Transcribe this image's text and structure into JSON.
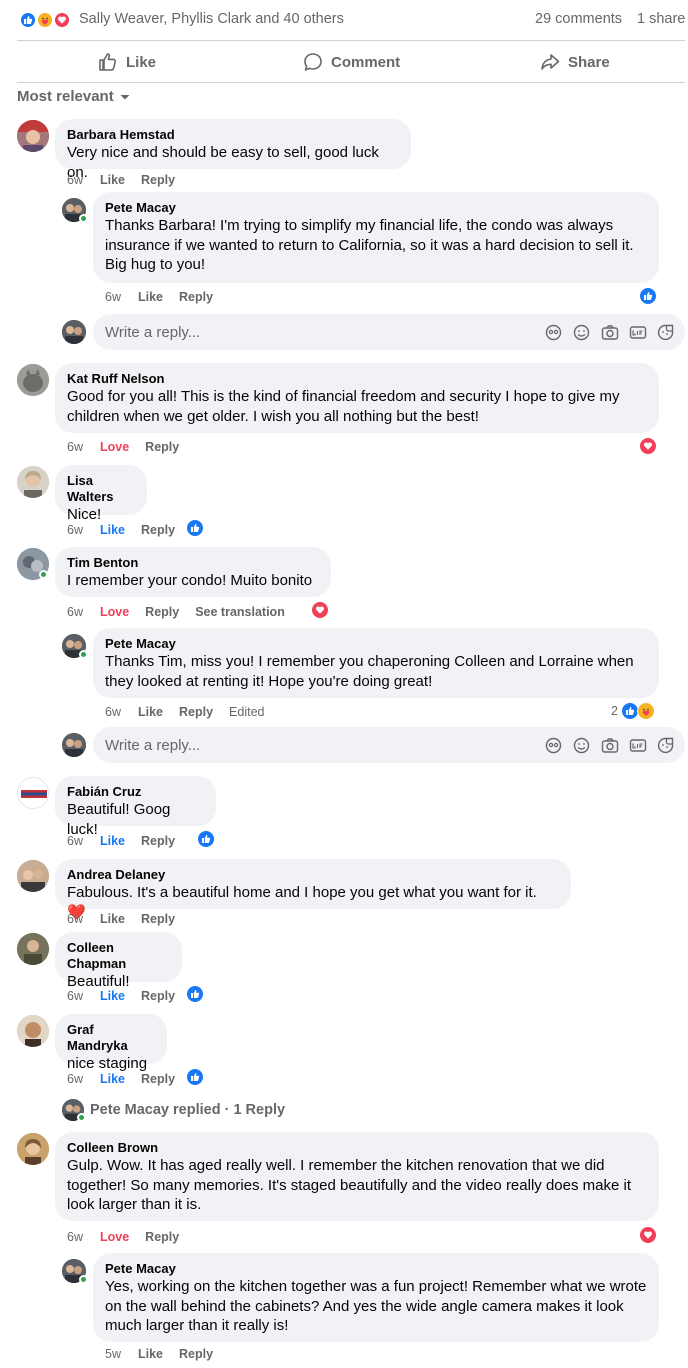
{
  "summary": {
    "reactions": [
      "like-icon",
      "care-icon",
      "love-icon"
    ],
    "names": "Sally Weaver, Phyllis Clark and 40 others",
    "comments": "29 comments",
    "shares": "1 share"
  },
  "actions": {
    "like": "Like",
    "comment": "Comment",
    "share": "Share"
  },
  "sort": {
    "label": "Most relevant"
  },
  "reply_placeholder": "Write a reply...",
  "labels": {
    "like": "Like",
    "reply": "Reply",
    "love": "Love",
    "edited": "Edited",
    "see_translation": "See translation"
  },
  "colors": {
    "like": "#1877f2",
    "love": "#f33e58",
    "care": "#f7b125",
    "bubble": "#f0f2f5",
    "meta": "#65676b"
  },
  "comments": [
    {
      "author": "Barbara Hemstad",
      "lines": [
        "Very nice and should be easy to sell, good luck on."
      ],
      "time": "6w"
    },
    {
      "author": "Pete Macay",
      "lines": [
        "Thanks Barbara! I'm trying to simplify my financial life, the condo was always",
        "insurance if we wanted to return to California, so it was a hard decision to sell it.",
        "Big hug to you!"
      ],
      "time": "6w"
    },
    {
      "author": "Kat Ruff Nelson",
      "lines": [
        "Good for you all! This is the kind of financial freedom and security I hope to give my",
        "children when we get older. I wish you all nothing but the best!"
      ],
      "time": "6w"
    },
    {
      "author": "Lisa Walters",
      "lines": [
        "Nice!"
      ],
      "time": "6w"
    },
    {
      "author": "Tim Benton",
      "lines": [
        "I remember your condo! Muito bonito"
      ],
      "time": "6w"
    },
    {
      "author": "Pete Macay",
      "lines": [
        "Thanks Tim, miss you! I remember you chaperoning Colleen and Lorraine when",
        "they looked at renting it! Hope you're doing great!"
      ],
      "time": "6w",
      "reaction_count": "2"
    },
    {
      "author": "Fabián Cruz",
      "lines": [
        "Beautiful! Goog luck!"
      ],
      "time": "6w"
    },
    {
      "author": "Andrea Delaney",
      "lines": [
        "Fabulous. It's a beautiful home and I hope you get what you want for it. ❤️"
      ],
      "time": "6w"
    },
    {
      "author": "Colleen Chapman",
      "lines": [
        "Beautiful!"
      ],
      "time": "6w"
    },
    {
      "author": "Graf Mandryka",
      "lines": [
        "nice staging"
      ],
      "time": "6w"
    },
    {
      "author": "Colleen Brown",
      "lines": [
        "Gulp. Wow. It has aged really well. I remember the kitchen renovation that we did",
        "together! So many memories. It's staged beautifully and the video really does make it",
        "look larger than it is."
      ],
      "time": "6w"
    },
    {
      "author": "Pete Macay",
      "lines": [
        "Yes, working on the kitchen together was a fun project! Remember what we wrote",
        "on the wall behind the cabinets? And yes the wide angle camera makes it look",
        "much larger than it really is!"
      ],
      "time": "5w"
    }
  ],
  "replied": {
    "author": "Pete Macay",
    "suffix": " replied · 1 Reply"
  }
}
